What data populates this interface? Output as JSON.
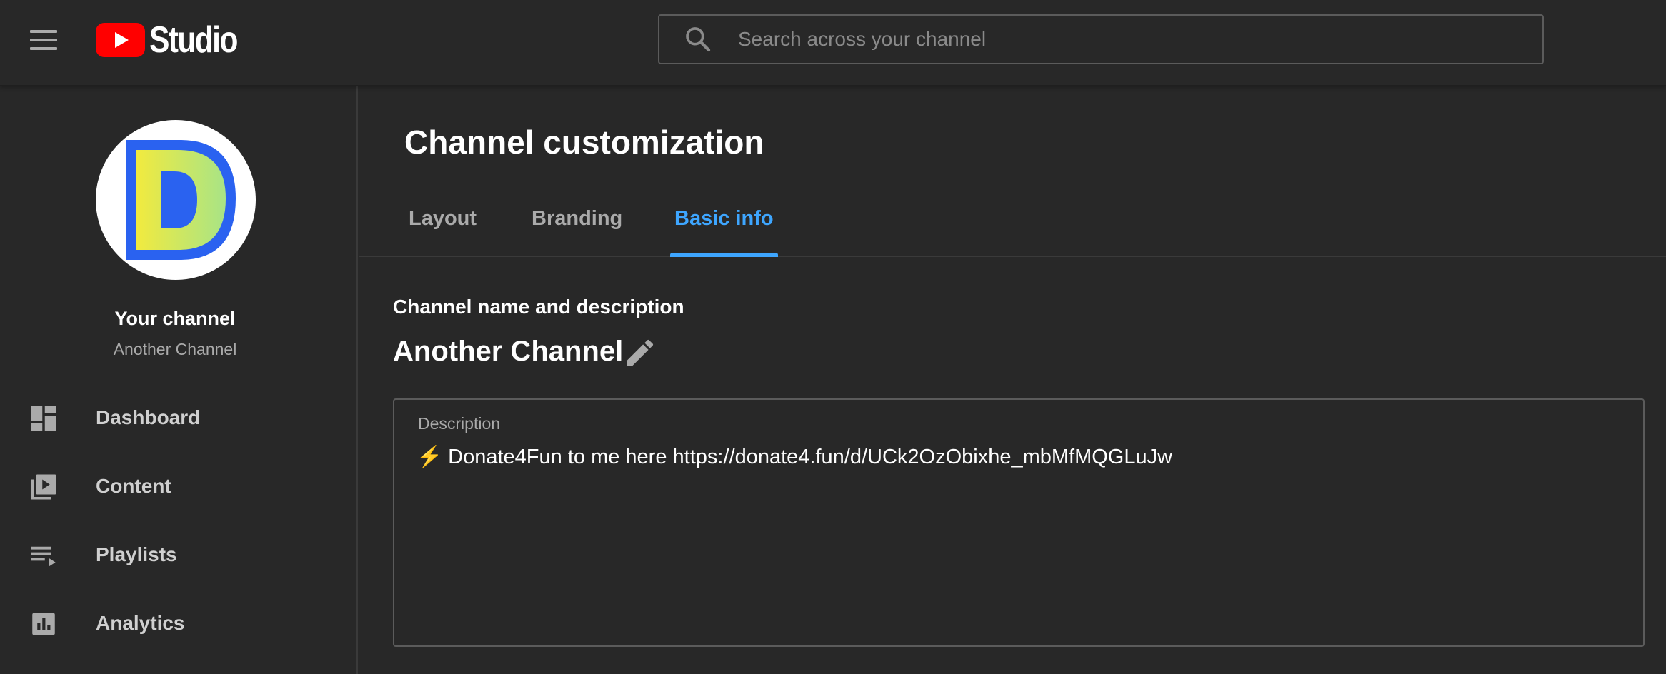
{
  "app": {
    "logo_text": "Studio",
    "search_placeholder": "Search across your channel"
  },
  "sidebar": {
    "channel_title": "Your channel",
    "channel_name": "Another Channel",
    "items": [
      {
        "label": "Dashboard",
        "icon": "dashboard-icon"
      },
      {
        "label": "Content",
        "icon": "content-icon"
      },
      {
        "label": "Playlists",
        "icon": "playlists-icon"
      },
      {
        "label": "Analytics",
        "icon": "analytics-icon"
      }
    ]
  },
  "main": {
    "title": "Channel customization",
    "tabs": [
      {
        "label": "Layout",
        "active": false
      },
      {
        "label": "Branding",
        "active": false
      },
      {
        "label": "Basic info",
        "active": true
      }
    ],
    "section_title": "Channel name and description",
    "channel_name": "Another Channel",
    "description": {
      "label": "Description",
      "value": "⚡ Donate4Fun to me here https://donate4.fun/d/UCk2OzObixhe_mbMfMQGLuJw"
    }
  },
  "colors": {
    "background": "#282828",
    "accent": "#3ea6ff",
    "logo_red": "#ff0000",
    "avatar_blue": "#2a62f0",
    "avatar_yellow": "#e8ec4a"
  }
}
